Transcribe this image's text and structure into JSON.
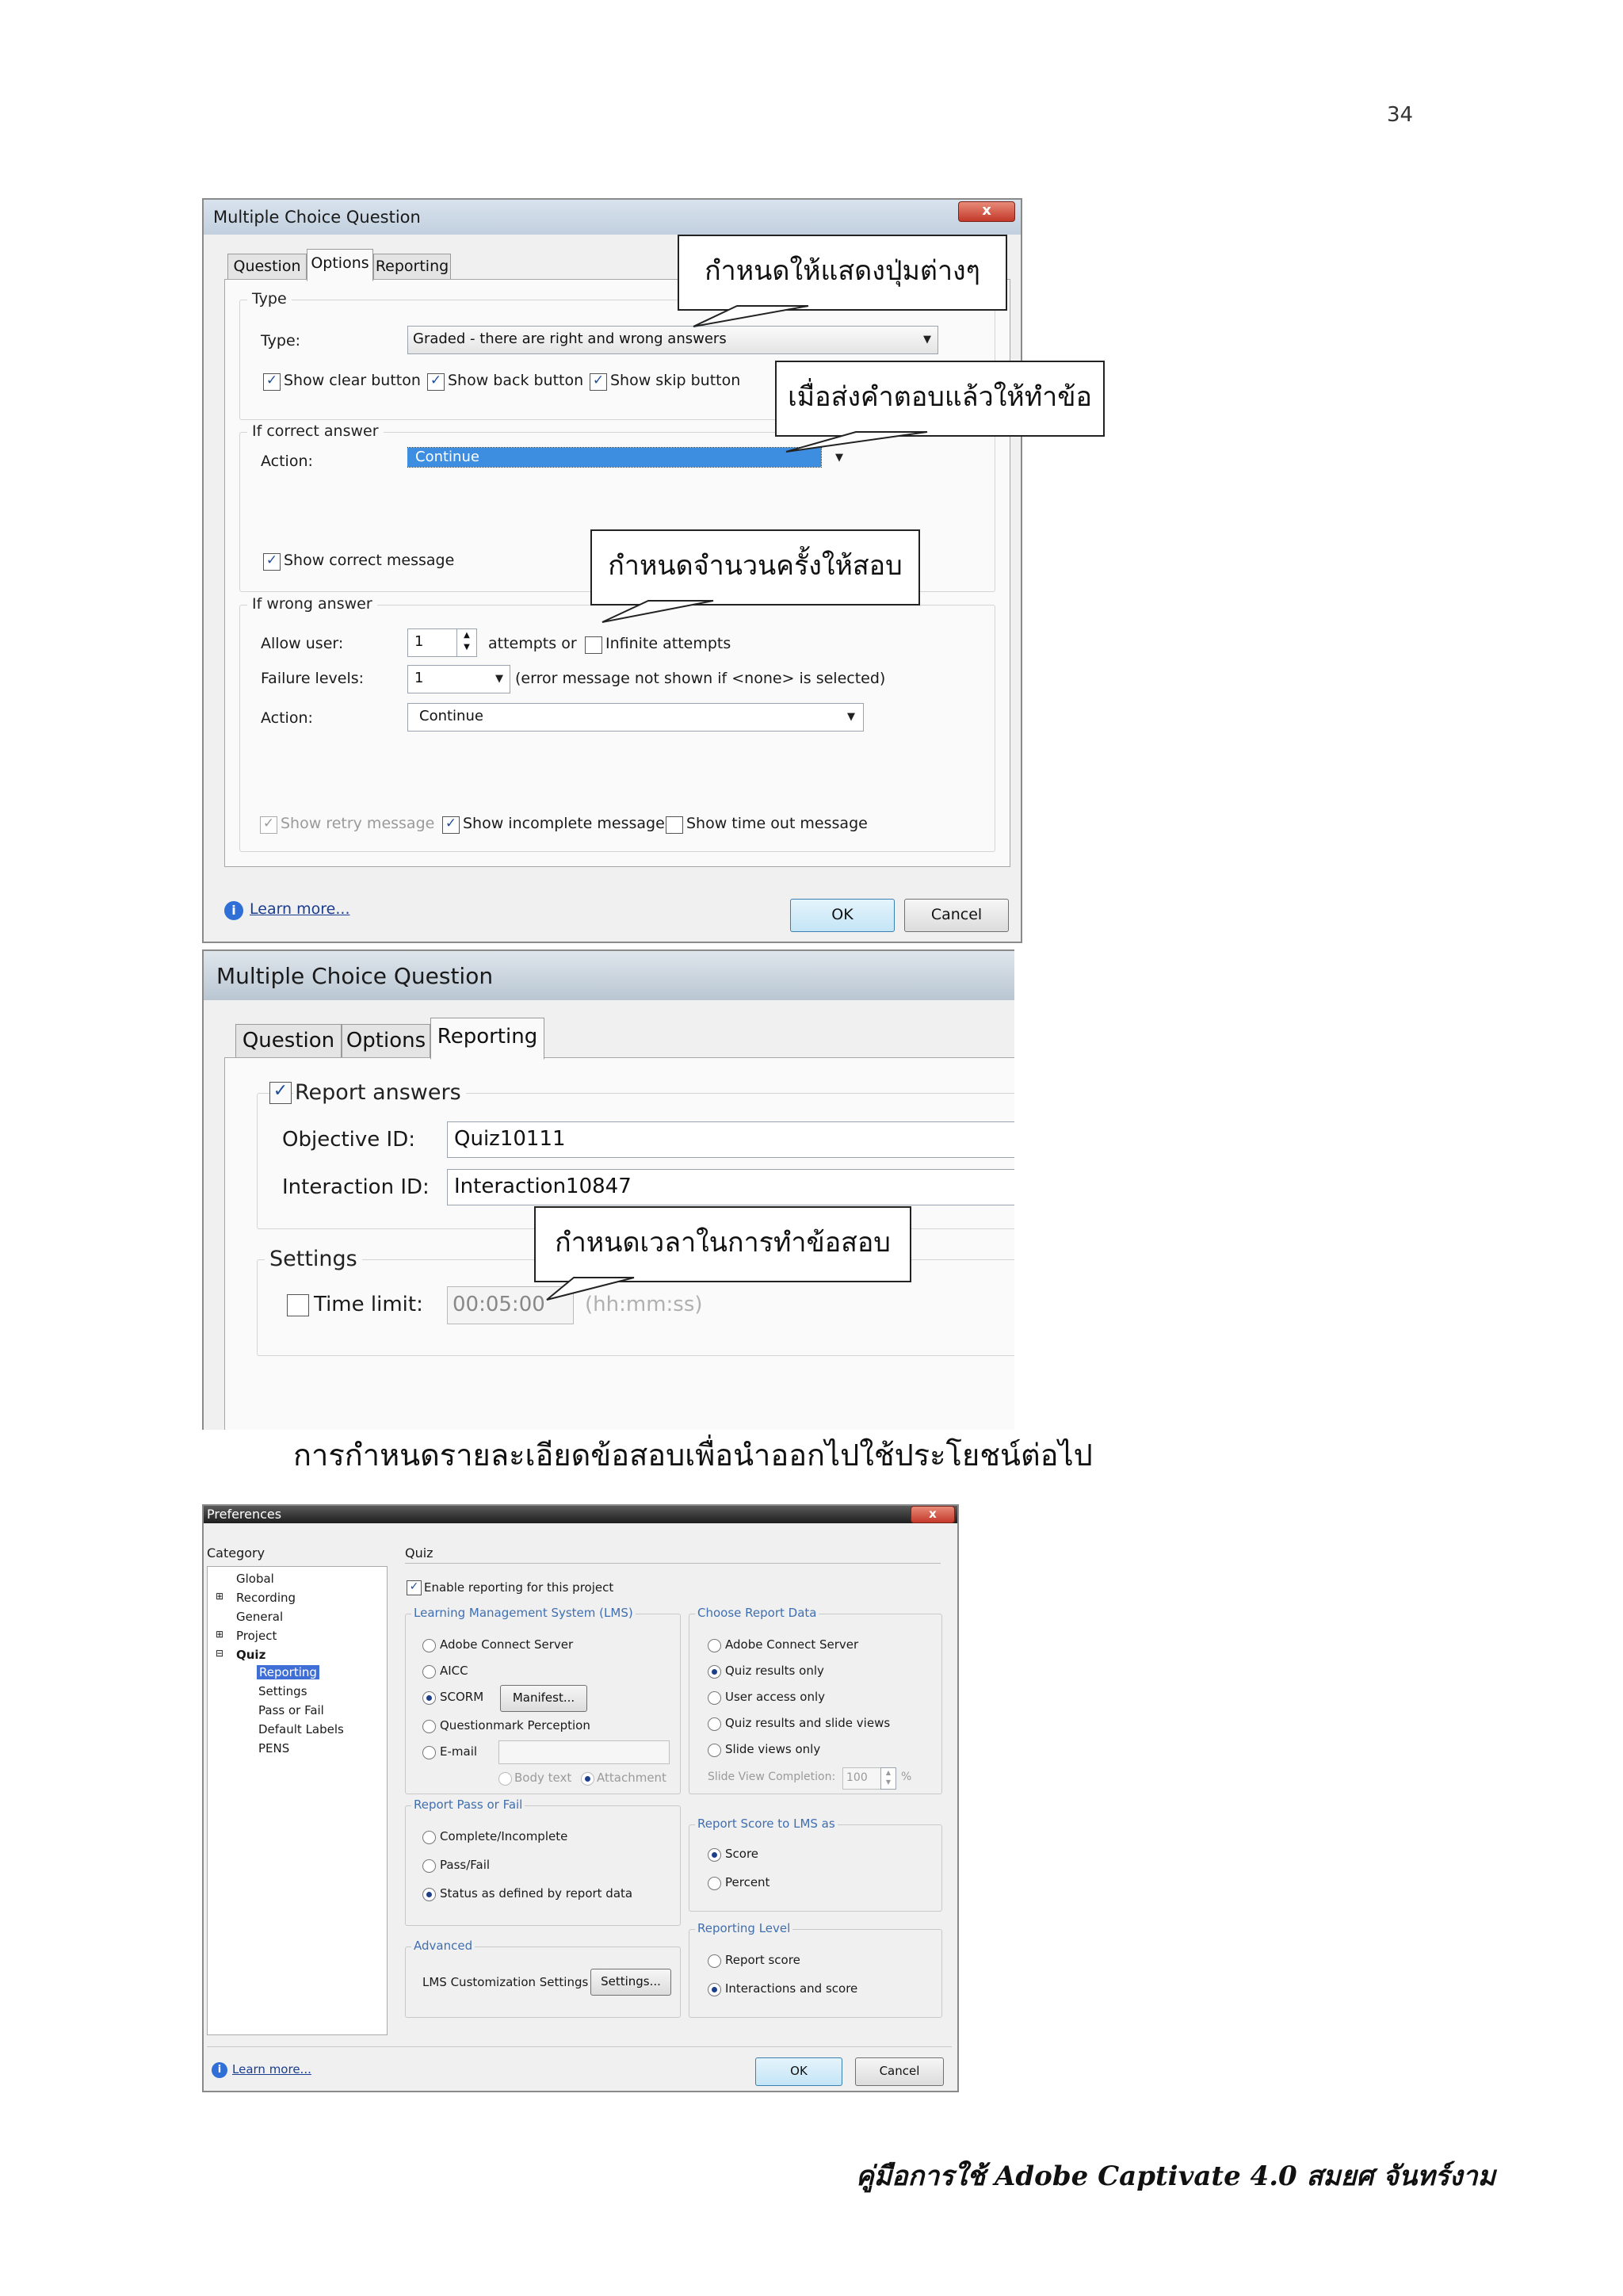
{
  "page_number": "34",
  "footer": "คู่มือการใช้ Adobe Captivate 4.0 สมยศ จันทร์งาม",
  "caption": "การกำหนดรายละเอียดข้อสอบเพื่อนำออกไปใช้ประโยชน์ต่อไป",
  "dialog1": {
    "title": "Multiple Choice Question",
    "close": "x",
    "tabs": [
      "Question",
      "Options",
      "Reporting"
    ],
    "type_group": "Type",
    "type_label": "Type:",
    "type_value": "Graded - there are right and wrong answers",
    "show_clear": "Show clear button",
    "show_back": "Show back button",
    "show_skip": "Show skip button",
    "correct_group": "If correct answer",
    "action_label": "Action:",
    "correct_action": "Continue",
    "show_correct": "Show correct message",
    "wrong_group": "If wrong answer",
    "allow_user": "Allow user:",
    "attempts_value": "1",
    "attempts_or": "attempts or",
    "infinite": "Infinite attempts",
    "failure_levels": "Failure levels:",
    "failure_value": "1",
    "failure_note": "(error message not shown if <none> is selected)",
    "wrong_action": "Continue",
    "show_retry": "Show retry message",
    "show_incomplete": "Show incomplete message",
    "show_timeout": "Show time out message",
    "learn_more": "Learn more...",
    "ok": "OK",
    "cancel": "Cancel"
  },
  "callouts": {
    "c1": "กำหนดให้แสดงปุ่มต่างๆ",
    "c2": "เมื่อส่งคำตอบแล้วให้ทำข้อ",
    "c3": "กำหนดจำนวนครั้งให้สอบ",
    "c4": "กำหนดเวลาในการทำข้อสอบ"
  },
  "dialog2": {
    "title": "Multiple Choice Question",
    "tabs": [
      "Question",
      "Options",
      "Reporting"
    ],
    "report_answers": "Report answers",
    "objective_label": "Objective ID:",
    "objective_value": "Quiz10111",
    "interaction_label": "Interaction ID:",
    "interaction_value": "Interaction10847",
    "settings": "Settings",
    "time_limit": "Time limit:",
    "time_value": "00:05:00",
    "time_format": "(hh:mm:ss)"
  },
  "dialog3": {
    "title": "Preferences",
    "close": "x",
    "category": "Category",
    "tree": [
      "Global",
      "Recording",
      "General",
      "Project",
      "Quiz",
      "Reporting",
      "Settings",
      "Pass or Fail",
      "Default Labels",
      "PENS"
    ],
    "quiz": "Quiz",
    "enable_reporting": "Enable reporting for this project",
    "lms_group": "Learning Management System (LMS)",
    "lms_options": [
      "Adobe Connect Server",
      "AICC",
      "SCORM",
      "Questionmark Perception",
      "E-mail"
    ],
    "manifest": "Manifest...",
    "body_text": "Body text",
    "attachment": "Attachment",
    "report_data_group": "Choose Report Data",
    "report_data_options": [
      "Adobe Connect Server",
      "Quiz results only",
      "User access only",
      "Quiz results and slide views",
      "Slide views only"
    ],
    "slide_view_completion": "Slide View Completion:",
    "slide_view_value": "100",
    "percent": "%",
    "pass_fail_group": "Report Pass or Fail",
    "pass_fail_options": [
      "Complete/Incomplete",
      "Pass/Fail",
      "Status as defined by report data"
    ],
    "score_group": "Report Score to LMS as",
    "score_options": [
      "Score",
      "Percent"
    ],
    "level_group": "Reporting Level",
    "level_options": [
      "Report score",
      "Interactions and score"
    ],
    "advanced_group": "Advanced",
    "lms_custom": "LMS Customization Settings",
    "settings_btn": "Settings...",
    "learn_more": "Learn more...",
    "ok": "OK",
    "cancel": "Cancel"
  }
}
